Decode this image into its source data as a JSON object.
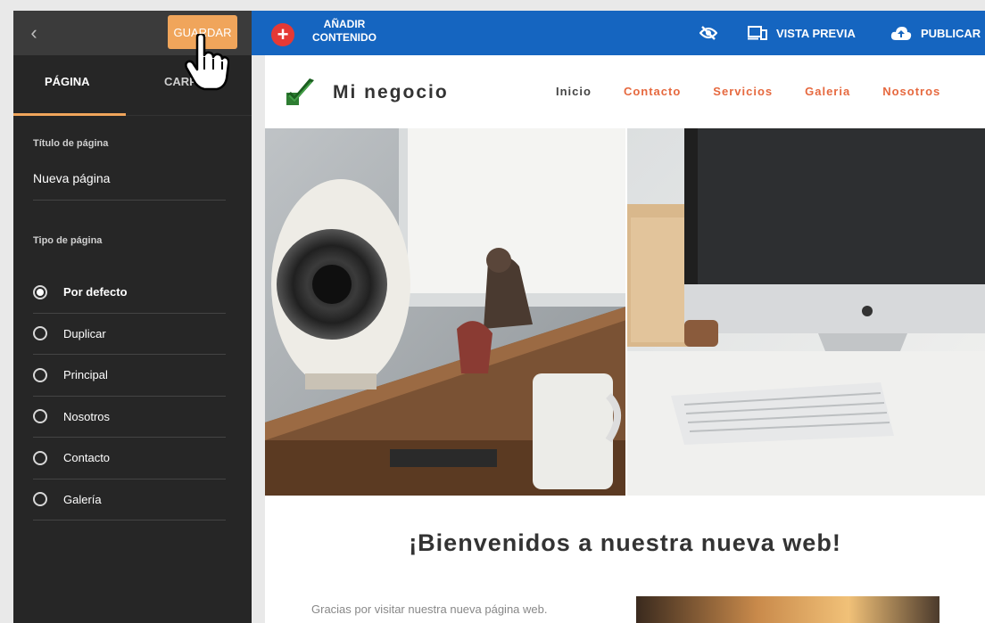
{
  "sidebar": {
    "save_label": "GUARDAR",
    "tabs": [
      "PÁGINA",
      "CARPETA"
    ],
    "title_label": "Título de página",
    "title_value": "Nueva página",
    "type_label": "Tipo de página",
    "page_types": [
      {
        "label": "Por defecto",
        "selected": true
      },
      {
        "label": "Duplicar",
        "selected": false
      },
      {
        "label": "Principal",
        "selected": false
      },
      {
        "label": "Nosotros",
        "selected": false
      },
      {
        "label": "Contacto",
        "selected": false
      },
      {
        "label": "Galería",
        "selected": false
      }
    ]
  },
  "topbar": {
    "add_line1": "AÑADIR",
    "add_line2": "CONTENIDO",
    "preview_label": "VISTA PREVIA",
    "publish_label": "PUBLICAR"
  },
  "site": {
    "name": "Mi negocio",
    "nav": [
      "Inicio",
      "Contacto",
      "Servicios",
      "Galeria",
      "Nosotros"
    ],
    "welcome": "¡Bienvenidos a nuestra nueva web!",
    "intro": "Gracias por visitar nuestra nueva página web."
  },
  "colors": {
    "accent": "#f0a55b",
    "topbar": "#1565c0",
    "nav_link": "#e6693f",
    "add_button": "#e53935"
  },
  "icons": {
    "back": "chevron-left-icon",
    "add": "plus-icon",
    "hide": "eye-off-icon",
    "preview": "devices-icon",
    "publish": "cloud-upload-icon",
    "logo": "checkmark-icon",
    "cursor": "hand-pointer-icon"
  }
}
